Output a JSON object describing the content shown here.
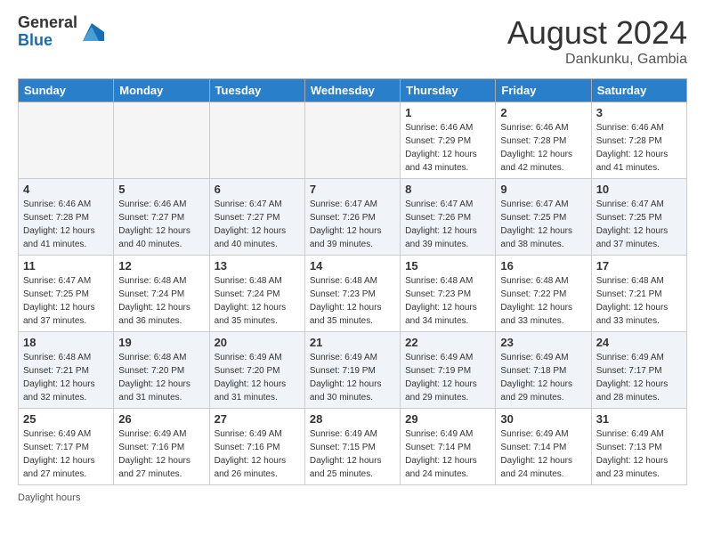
{
  "header": {
    "logo_general": "General",
    "logo_blue": "Blue",
    "month_title": "August 2024",
    "location": "Dankunku, Gambia"
  },
  "days_of_week": [
    "Sunday",
    "Monday",
    "Tuesday",
    "Wednesday",
    "Thursday",
    "Friday",
    "Saturday"
  ],
  "weeks": [
    [
      {
        "day": "",
        "info": ""
      },
      {
        "day": "",
        "info": ""
      },
      {
        "day": "",
        "info": ""
      },
      {
        "day": "",
        "info": ""
      },
      {
        "day": "1",
        "info": "Sunrise: 6:46 AM\nSunset: 7:29 PM\nDaylight: 12 hours and 43 minutes."
      },
      {
        "day": "2",
        "info": "Sunrise: 6:46 AM\nSunset: 7:28 PM\nDaylight: 12 hours and 42 minutes."
      },
      {
        "day": "3",
        "info": "Sunrise: 6:46 AM\nSunset: 7:28 PM\nDaylight: 12 hours and 41 minutes."
      }
    ],
    [
      {
        "day": "4",
        "info": "Sunrise: 6:46 AM\nSunset: 7:28 PM\nDaylight: 12 hours and 41 minutes."
      },
      {
        "day": "5",
        "info": "Sunrise: 6:46 AM\nSunset: 7:27 PM\nDaylight: 12 hours and 40 minutes."
      },
      {
        "day": "6",
        "info": "Sunrise: 6:47 AM\nSunset: 7:27 PM\nDaylight: 12 hours and 40 minutes."
      },
      {
        "day": "7",
        "info": "Sunrise: 6:47 AM\nSunset: 7:26 PM\nDaylight: 12 hours and 39 minutes."
      },
      {
        "day": "8",
        "info": "Sunrise: 6:47 AM\nSunset: 7:26 PM\nDaylight: 12 hours and 39 minutes."
      },
      {
        "day": "9",
        "info": "Sunrise: 6:47 AM\nSunset: 7:25 PM\nDaylight: 12 hours and 38 minutes."
      },
      {
        "day": "10",
        "info": "Sunrise: 6:47 AM\nSunset: 7:25 PM\nDaylight: 12 hours and 37 minutes."
      }
    ],
    [
      {
        "day": "11",
        "info": "Sunrise: 6:47 AM\nSunset: 7:25 PM\nDaylight: 12 hours and 37 minutes."
      },
      {
        "day": "12",
        "info": "Sunrise: 6:48 AM\nSunset: 7:24 PM\nDaylight: 12 hours and 36 minutes."
      },
      {
        "day": "13",
        "info": "Sunrise: 6:48 AM\nSunset: 7:24 PM\nDaylight: 12 hours and 35 minutes."
      },
      {
        "day": "14",
        "info": "Sunrise: 6:48 AM\nSunset: 7:23 PM\nDaylight: 12 hours and 35 minutes."
      },
      {
        "day": "15",
        "info": "Sunrise: 6:48 AM\nSunset: 7:23 PM\nDaylight: 12 hours and 34 minutes."
      },
      {
        "day": "16",
        "info": "Sunrise: 6:48 AM\nSunset: 7:22 PM\nDaylight: 12 hours and 33 minutes."
      },
      {
        "day": "17",
        "info": "Sunrise: 6:48 AM\nSunset: 7:21 PM\nDaylight: 12 hours and 33 minutes."
      }
    ],
    [
      {
        "day": "18",
        "info": "Sunrise: 6:48 AM\nSunset: 7:21 PM\nDaylight: 12 hours and 32 minutes."
      },
      {
        "day": "19",
        "info": "Sunrise: 6:48 AM\nSunset: 7:20 PM\nDaylight: 12 hours and 31 minutes."
      },
      {
        "day": "20",
        "info": "Sunrise: 6:49 AM\nSunset: 7:20 PM\nDaylight: 12 hours and 31 minutes."
      },
      {
        "day": "21",
        "info": "Sunrise: 6:49 AM\nSunset: 7:19 PM\nDaylight: 12 hours and 30 minutes."
      },
      {
        "day": "22",
        "info": "Sunrise: 6:49 AM\nSunset: 7:19 PM\nDaylight: 12 hours and 29 minutes."
      },
      {
        "day": "23",
        "info": "Sunrise: 6:49 AM\nSunset: 7:18 PM\nDaylight: 12 hours and 29 minutes."
      },
      {
        "day": "24",
        "info": "Sunrise: 6:49 AM\nSunset: 7:17 PM\nDaylight: 12 hours and 28 minutes."
      }
    ],
    [
      {
        "day": "25",
        "info": "Sunrise: 6:49 AM\nSunset: 7:17 PM\nDaylight: 12 hours and 27 minutes."
      },
      {
        "day": "26",
        "info": "Sunrise: 6:49 AM\nSunset: 7:16 PM\nDaylight: 12 hours and 27 minutes."
      },
      {
        "day": "27",
        "info": "Sunrise: 6:49 AM\nSunset: 7:16 PM\nDaylight: 12 hours and 26 minutes."
      },
      {
        "day": "28",
        "info": "Sunrise: 6:49 AM\nSunset: 7:15 PM\nDaylight: 12 hours and 25 minutes."
      },
      {
        "day": "29",
        "info": "Sunrise: 6:49 AM\nSunset: 7:14 PM\nDaylight: 12 hours and 24 minutes."
      },
      {
        "day": "30",
        "info": "Sunrise: 6:49 AM\nSunset: 7:14 PM\nDaylight: 12 hours and 24 minutes."
      },
      {
        "day": "31",
        "info": "Sunrise: 6:49 AM\nSunset: 7:13 PM\nDaylight: 12 hours and 23 minutes."
      }
    ]
  ],
  "footer": {
    "label": "Daylight hours"
  }
}
